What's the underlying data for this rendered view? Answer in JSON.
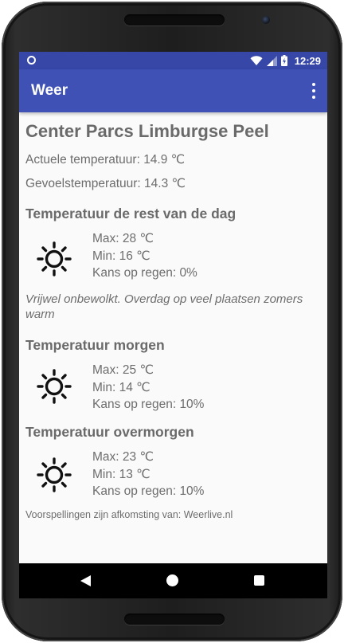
{
  "status_bar": {
    "time": "12:29",
    "icons": [
      "circle-notification-icon",
      "wifi-icon",
      "signal-icon",
      "battery-charging-icon"
    ]
  },
  "app_bar": {
    "title": "Weer",
    "menu_icon": "overflow-menu-icon"
  },
  "location": "Center Parcs Limburgse Peel",
  "current": {
    "actual": "Actuele temperatuur: 14.9 ℃",
    "feels": "Gevoelstemperatuur: 14.3 ℃"
  },
  "forecasts": [
    {
      "heading": "Temperatuur de rest van de dag",
      "icon": "sun-icon",
      "max": "Max: 28 ℃",
      "min": "Min: 16 ℃",
      "rain": "Kans op regen: 0%",
      "description": "Vrijwel onbewolkt. Overdag op veel plaatsen zomers warm"
    },
    {
      "heading": "Temperatuur morgen",
      "icon": "sun-icon",
      "max": "Max: 25 ℃",
      "min": "Min: 14 ℃",
      "rain": "Kans op regen: 10%"
    },
    {
      "heading": "Temperatuur overmorgen",
      "icon": "sun-icon",
      "max": "Max: 23 ℃",
      "min": "Min: 13 ℃",
      "rain": "Kans op regen: 10%"
    }
  ],
  "source": "Voorspellingen zijn afkomsting van: Weerlive.nl",
  "nav_bar": {
    "icons": [
      "back-icon",
      "home-icon",
      "recents-icon"
    ]
  },
  "colors": {
    "status_bar": "#3647a8",
    "app_bar": "#3f51b5",
    "content_bg": "#fafafa",
    "text": "#6d6d6d"
  }
}
